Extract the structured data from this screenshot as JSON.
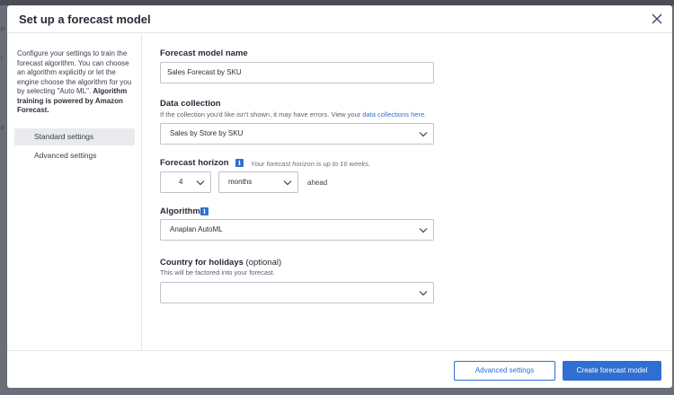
{
  "dialog": {
    "title": "Set up a forecast model"
  },
  "sidebar": {
    "description": "Configure your settings to train the forecast algorithm. You can choose an algorithm explicitly or let the engine choose the algorithm for you by selecting \"Auto ML\".",
    "description_bold": "Algorithm training is powered by Amazon Forecast.",
    "items": [
      {
        "label": "Standard settings",
        "active": true
      },
      {
        "label": "Advanced settings",
        "active": false
      }
    ]
  },
  "form": {
    "model_name": {
      "label": "Forecast model name",
      "value": "Sales Forecast by SKU"
    },
    "data_collection": {
      "label": "Data collection",
      "helper": "If the collection you'd like isn't shown, it may have errors.  View your ",
      "helper_link": "data collections here.",
      "value": "Sales by Store by SKU"
    },
    "forecast_horizon": {
      "label": "Forecast horizon",
      "hint": "Your forecast horizon is up to 16 weeks.",
      "amount": "4",
      "unit": "months",
      "suffix": "ahead"
    },
    "algorithm": {
      "label": "Algorithm",
      "value": "Anaplan AutoML"
    },
    "country": {
      "label": "Country for holidays",
      "label_optional": "(optional)",
      "helper": "This will be factored into your forecast.",
      "value": ""
    }
  },
  "footer": {
    "secondary_label": "Advanced settings",
    "primary_label": "Create forecast model"
  },
  "icons": {
    "close": "close-icon",
    "chevron": "chevron-down-icon",
    "info": "info-icon"
  },
  "colors": {
    "accent": "#2f6fd1",
    "backdrop": "#6b6e76"
  }
}
